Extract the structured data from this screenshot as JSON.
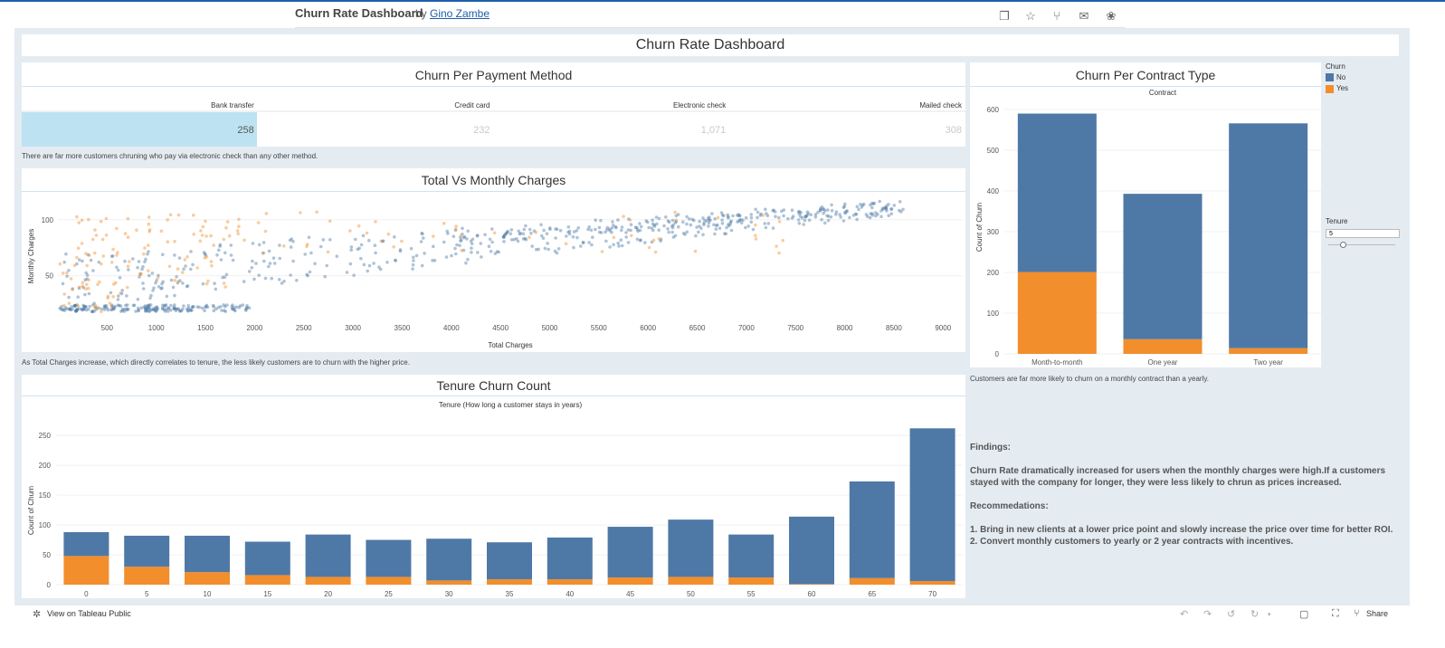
{
  "header": {
    "title": "Churn Rate Dashboard",
    "by": "by",
    "author": "Gino Zambe"
  },
  "dashboard": {
    "title": "Churn Rate Dashboard",
    "payment": {
      "title": "Churn Per Payment Method",
      "caption": "There are far more customers chruning who pay via electronic check than any other method."
    },
    "scatter": {
      "title": "Total Vs Monthly Charges",
      "caption": "As Total Charges increase, which directly correlates to tenure, the less likely customers are to churn with the higher price."
    },
    "tenure": {
      "title": "Tenure Churn Count"
    },
    "contract": {
      "title": "Churn Per Contract Type",
      "caption": "Customers are far more likely to churn on a monthly contract than a yearly."
    },
    "legend": {
      "title": "Churn",
      "items": [
        {
          "label": "No",
          "color": "#4e79a7"
        },
        {
          "label": "Yes",
          "color": "#f28e2b"
        }
      ]
    },
    "tenure_filter": {
      "label": "Tenure",
      "value": "5"
    },
    "findings": {
      "heading": "Findings:",
      "text": "Churn Rate dramatically increased for users when the monthly charges were high.If a customers stayed with the company for longer, they were less likely to chrun as prices increased.",
      "rec_heading": "Recommedations:",
      "rec1": "1. Bring in new clients at a lower price point and slowly increase the price over time for better ROI.",
      "rec2": "2. Convert monthly customers to yearly or 2 year contracts with incentives."
    }
  },
  "footer": {
    "view_label": "View on Tableau Public",
    "share_label": "Share"
  },
  "chart_data": [
    {
      "type": "table",
      "title": "Churn Per Payment Method",
      "categories": [
        "Bank transfer",
        "Credit card",
        "Electronic check",
        "Mailed check"
      ],
      "value_labels": [
        "258",
        "232",
        "1,071",
        "308"
      ],
      "values": [
        258,
        232,
        1071,
        308
      ],
      "highlighted": "Bank transfer"
    },
    {
      "type": "scatter",
      "title": "Total Vs Monthly Charges",
      "xlabel": "Total Charges",
      "ylabel": "Monthly Charges",
      "xticks": [
        500,
        1000,
        1500,
        2000,
        2500,
        3000,
        3500,
        4000,
        4500,
        5000,
        5500,
        6000,
        6500,
        7000,
        7500,
        8000,
        8500,
        9000
      ],
      "xtick_labels": [
        "500",
        "1000",
        "1500",
        "2000",
        "2500",
        "3000",
        "3500",
        "4000",
        "4500",
        "5000",
        "5500",
        "6000",
        "6500",
        "7000",
        "7500",
        "8000",
        "8500",
        "9000"
      ],
      "yticks": [
        50,
        100
      ],
      "ytick_labels": [
        "50",
        "100"
      ],
      "xlim": [
        0,
        9200
      ],
      "ylim": [
        15,
        120
      ],
      "series": [
        {
          "name": "No",
          "color": "#4e79a7"
        },
        {
          "name": "Yes",
          "color": "#f28e2b"
        }
      ]
    },
    {
      "type": "bar",
      "title": "Tenure Churn Count",
      "subtitle": "Tenure (How long a customer stays in years)",
      "ylabel": "Count of Churn",
      "categories": [
        "0",
        "5",
        "10",
        "15",
        "20",
        "25",
        "30",
        "35",
        "40",
        "45",
        "50",
        "55",
        "60",
        "65",
        "70"
      ],
      "stacked": true,
      "series": [
        {
          "name": "No",
          "values": [
            40,
            52,
            61,
            56,
            71,
            62,
            70,
            62,
            70,
            85,
            96,
            72,
            113,
            162,
            256
          ]
        },
        {
          "name": "Yes",
          "values": [
            48,
            30,
            21,
            16,
            13,
            13,
            7,
            9,
            9,
            12,
            13,
            12,
            1,
            11,
            6
          ]
        }
      ],
      "yticks": [
        0,
        50,
        100,
        150,
        200,
        250
      ],
      "ytick_labels": [
        "0",
        "50",
        "100",
        "150",
        "200",
        "250"
      ],
      "ylim": [
        0,
        270
      ]
    },
    {
      "type": "bar",
      "title": "Churn Per Contract Type",
      "subtitle": "Contract",
      "ylabel": "Count of Churn",
      "categories": [
        "Month-to-month",
        "One year",
        "Two year"
      ],
      "stacked": true,
      "series": [
        {
          "name": "No",
          "values": [
            389,
            357,
            552
          ]
        },
        {
          "name": "Yes",
          "values": [
            201,
            36,
            14
          ]
        }
      ],
      "yticks": [
        0,
        100,
        200,
        300,
        400,
        500,
        600
      ],
      "ytick_labels": [
        "0",
        "100",
        "200",
        "300",
        "400",
        "500",
        "600"
      ],
      "ylim": [
        0,
        620
      ]
    }
  ]
}
